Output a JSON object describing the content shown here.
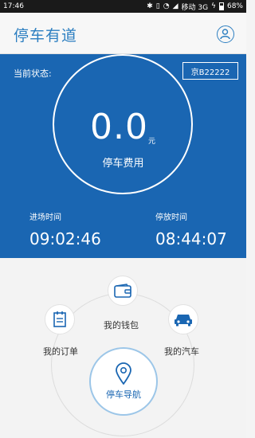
{
  "status_bar": {
    "time": "17:46",
    "carrier": "移动 3G",
    "battery": "68%"
  },
  "app": {
    "logo": "停车有道"
  },
  "parking": {
    "status_label": "当前状态:",
    "plate": "京B22222",
    "fee_value": "0.0",
    "fee_unit": "元",
    "fee_label": "停车费用",
    "entry_label": "进场时间",
    "entry_time": "09:02:46",
    "duration_label": "停放时间",
    "duration_time": "08:44:07"
  },
  "menu": {
    "wallet": "我的钱包",
    "orders": "我的订单",
    "cars": "我的汽车",
    "navigate": "停车导航"
  },
  "colors": {
    "primary": "#1a66b2",
    "accent": "#2d7fc1"
  }
}
